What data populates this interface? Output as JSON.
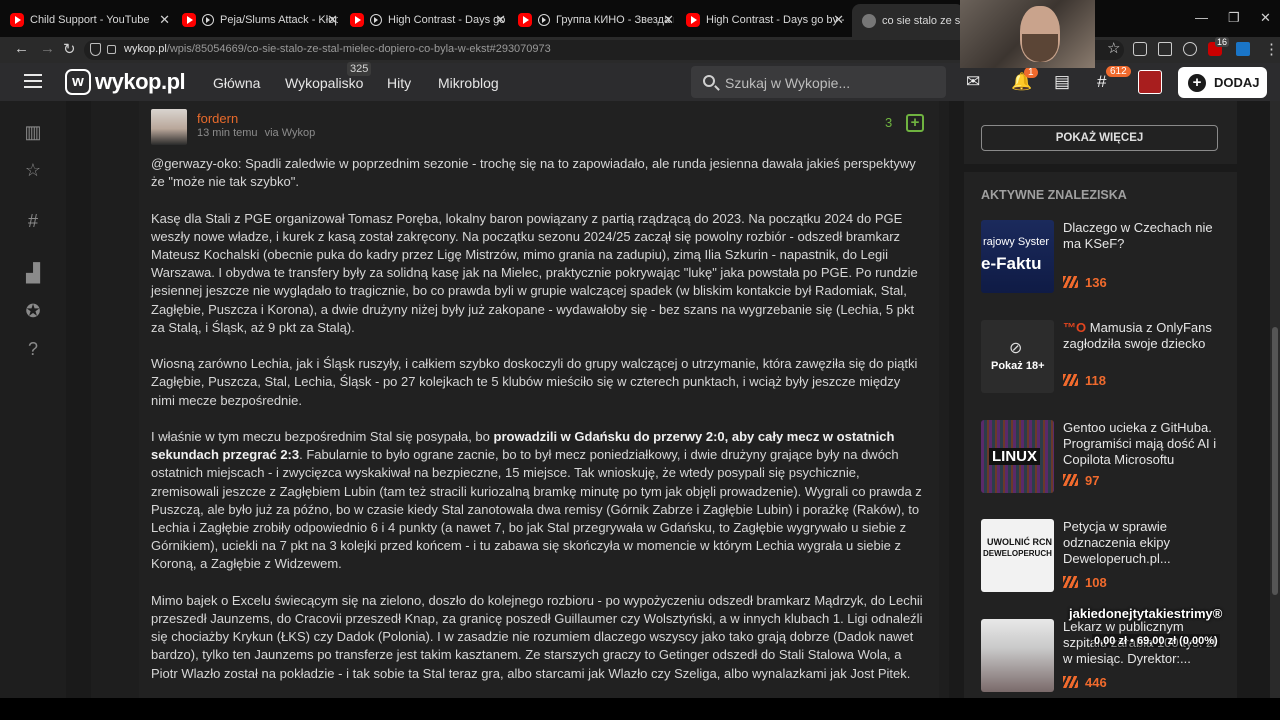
{
  "browser": {
    "tabs": [
      {
        "label": "Child Support - YouTube"
      },
      {
        "label": "Peja/Slums Attack - Kłopot"
      },
      {
        "label": "High Contrast - Days go by"
      },
      {
        "label": "Группа КИНО - Звезда по"
      },
      {
        "label": "High Contrast - Days go by - Yo"
      },
      {
        "label": "co sie stalo ze stal mi"
      }
    ],
    "url_domain": "wykop.pl",
    "url_path": "/wpis/85054669/co-sie-stalo-ze-stal-mielec-dopiero-co-byla-w-ekst#293070973",
    "ext_badge": "16"
  },
  "header": {
    "logo_text": "wykop.pl",
    "nav": [
      "Główna",
      "Wykopalisko",
      "Hity",
      "Mikroblog"
    ],
    "wykopalisko_count": "325",
    "search_placeholder": "Szukaj w Wykopie...",
    "notif_badge": "1",
    "tags_badge": "612",
    "add_label": "DODAJ"
  },
  "post": {
    "author": "fordern",
    "time": "13 min temu",
    "via": "via Wykop",
    "votes": "3",
    "mention": "@gerwazy-oko:",
    "p1_rest": " Spadli zaledwie w poprzednim sezonie - trochę się na to zapowiadało, ale runda jesienna dawała jakieś perspektywy że \"może nie tak szybko\".",
    "p2": "Kasę dla Stali z PGE organizował Tomasz Poręba, lokalny baron powiązany z partią rządzącą do 2023. Na początku 2024 do PGE weszły nowe władze, i kurek z kasą został zakręcony. Na początku sezonu 2024/25 zaczął się powolny rozbiór - odszedł bramkarz Mateusz Kochalski (obecnie puka do kadry przez Ligę Mistrzów, mimo grania na zadupiu), zimą Ilia Szkurin - napastnik, do Legii Warszawa. I obydwa te transfery były za solidną kasę jak na Mielec, praktycznie pokrywając \"lukę\" jaka powstała po PGE. Po rundzie jesiennej jeszcze nie wyglądało to tragicznie, bo co prawda byli w grupie walczącej spadek (w bliskim kontakcie był Radomiak, Stal, Zagłębie, Puszcza i Korona), a dwie drużyny niżej były już zakopane - wydawałoby się - bez szans na wygrzebanie się (Lechia, 5 pkt za Stalą, i Śląsk, aż 9 pkt za Stalą).",
    "p3": "Wiosną zarówno Lechia, jak i Śląsk ruszyły, i całkiem szybko doskoczyli do grupy walczącej o utrzymanie, która zawęziła się do piątki Zagłębie, Puszcza, Stal, Lechia, Śląsk - po 27 kolejkach te 5 klubów mieściło się w czterech punktach, i wciąż były jeszcze między nimi mecze bezpośrednie.",
    "p4_a": "I właśnie w tym meczu bezpośrednim Stal się posypała, bo ",
    "p4_bold": "prowadzili w Gdańsku do przerwy 2:0, aby cały mecz w ostatnich sekundach przegrać 2:3",
    "p4_b": ". Fabularnie to było ograne zacnie, bo to był mecz poniedziałkowy, i dwie drużyny grające były na dwóch ostatnich miejscach - i zwycięzca wyskakiwał na bezpieczne, 15 miejsce. Tak wnioskuję, że wtedy posypali się psychicznie, zremisowali jeszcze z Zagłębiem Lubin (tam też stracili kuriozalną bramkę minutę po tym jak objęli prowadzenie). Wygrali co prawda z Puszczą, ale było już za późno, bo w czasie kiedy Stal zanotowała dwa remisy (Górnik Zabrze i Zagłębie Lubin) i porażkę (Raków), to Lechia i Zagłębie zrobiły odpowiednio 6 i 4 punkty (a nawet 7, bo jak Stal przegrywała w Gdańsku, to Zagłębie wygrywało u siebie z Górnikiem), uciekli na 7 pkt na 3 kolejki przed końcem - i tu zabawa się skończyła w momencie w którym Lechia wygrała u siebie z Koroną, a Zagłębie z Widzewem.",
    "p5": "Mimo bajek o Excelu świecącym się na zielono, doszło do kolejnego rozbioru - po wypożyczeniu odszedł bramkarz Mądrzyk, do Lechii przeszedł Jaunzems, do Cracovii przeszedł Knap, za granicę poszedł Guillaumer czy Wolsztyński, a w innych klubach 1. Ligi odnaleźli się chociażby Krykun (ŁKS) czy Dadok (Polonia). I w zasadzie nie rozumiem dlaczego wszyscy jako tako grają dobrze (Dadok nawet bardzo), tylko ten Jaunzems po transferze jest takim kasztanem. Ze starszych graczy to Getinger odszedł do Stali Stalowa Wola, a Piotr Wlazło został na pokładzie - i tak sobie ta Stal teraz gra, albo starcami jak Wlazło czy Szeliga, albo wynalazkami jak Jost Pitek."
  },
  "sidebar": {
    "show_more": "POKAŻ WIĘCEJ",
    "active_title": "AKTYWNE ZNALEZISKA",
    "items": [
      {
        "title": "Dlaczego w Czechach nie ma KSeF?",
        "votes": "136",
        "thumb_text_1": "rajowy Syster",
        "thumb_text_2": "e-Faktu"
      },
      {
        "tag": "™O",
        "title": "Mamusia z OnlyFans zagłodziła swoje dziecko",
        "votes": "118",
        "nsfw_label": "Pokaż 18+"
      },
      {
        "title": "Gentoo ucieka z GitHuba. Programiści mają dość AI i Copilota Microsoftu",
        "votes": "97",
        "thumb_text_1": "LINUX"
      },
      {
        "title": "Petycja w sprawie odznaczenia ekipy Deweloperuch.pl...",
        "votes": "108",
        "thumb_text_1": "UWOLNIĆ RCN",
        "thumb_text_2": "DEWELOPERUCH"
      },
      {
        "title": "Lekarz w publicznym szpitalu zarabia 100 tys. zł w miesiąc. Dyrektor:...",
        "votes": "446"
      }
    ]
  },
  "overlay": {
    "line1": "jakiedonejtytakiestrimy®",
    "line2": "0,00 zł • 69,00 zł (0.00%)"
  }
}
